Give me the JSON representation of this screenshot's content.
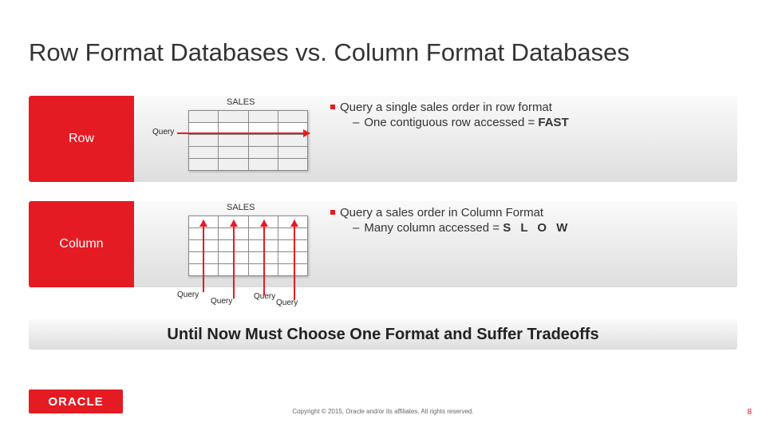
{
  "title": "Row Format Databases vs. Column Format Databases",
  "row_block": {
    "label": "Row",
    "table_title": "SALES",
    "query_label": "Query",
    "bullet": "Query a single sales order in row format",
    "sub": "One contiguous row accessed =",
    "fast": "FAST"
  },
  "col_block": {
    "label": "Column",
    "table_title": "SALES",
    "q1": "Query",
    "q2": "Query",
    "q3": "Query",
    "q4": "Query",
    "bullet": "Query a sales order in Column Format",
    "sub": "Many column accessed =",
    "slow": "S L O W"
  },
  "conclusion": "Until Now Must Choose One Format and Suffer Tradeoffs",
  "logo": "ORACLE",
  "copyright": "Copyright © 2015, Oracle and/or its affiliates. All rights reserved.",
  "pagenum": "8"
}
